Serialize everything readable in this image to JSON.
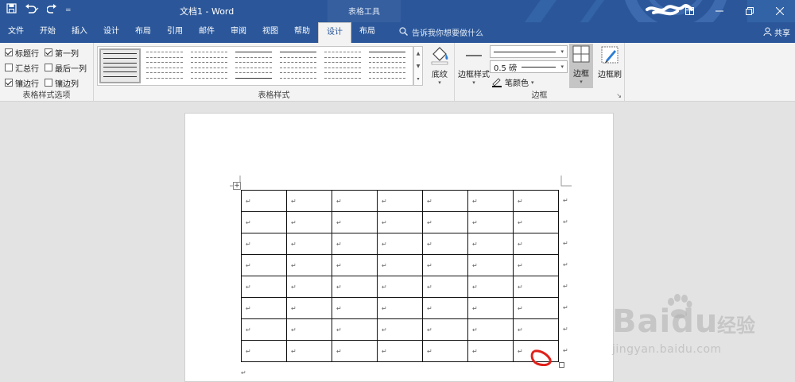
{
  "titlebar": {
    "doc_title": "文档1  -  Word",
    "context_tab": "表格工具",
    "qat_sep": "=",
    "colors": {
      "ribbon_blue": "#2b579a",
      "page_white": "#ffffff"
    }
  },
  "tabs": [
    {
      "label": "文件"
    },
    {
      "label": "开始"
    },
    {
      "label": "插入"
    },
    {
      "label": "设计"
    },
    {
      "label": "布局"
    },
    {
      "label": "引用"
    },
    {
      "label": "邮件"
    },
    {
      "label": "审阅"
    },
    {
      "label": "视图"
    },
    {
      "label": "帮助"
    },
    {
      "label": "设计",
      "active": true
    },
    {
      "label": "布局"
    }
  ],
  "tellme": {
    "label": "告诉我你想要做什么"
  },
  "share": {
    "label": "共享"
  },
  "style_options": {
    "group_label": "表格样式选项",
    "items": [
      {
        "label": "标题行",
        "checked": true
      },
      {
        "label": "第一列",
        "checked": true
      },
      {
        "label": "汇总行",
        "checked": false
      },
      {
        "label": "最后一列",
        "checked": false
      },
      {
        "label": "镶边行",
        "checked": true
      },
      {
        "label": "镶边列",
        "checked": false
      }
    ]
  },
  "table_styles": {
    "group_label": "表格样式",
    "shading_label": "底纹"
  },
  "borders": {
    "group_label": "边框",
    "border_style_label": "边框样式",
    "line_weight": "0.5 磅",
    "pen_color_label": "笔颜色",
    "borders_label": "边框",
    "painter_label": "边框刷"
  },
  "document": {
    "rows": 8,
    "cols": 7,
    "cell_mark": "↵",
    "paragraph_mark": "↵",
    "move_handle_glyph": "+"
  },
  "watermark": {
    "brand": "Baidu",
    "cn": "经验",
    "url": "jingyan.baidu.com"
  }
}
